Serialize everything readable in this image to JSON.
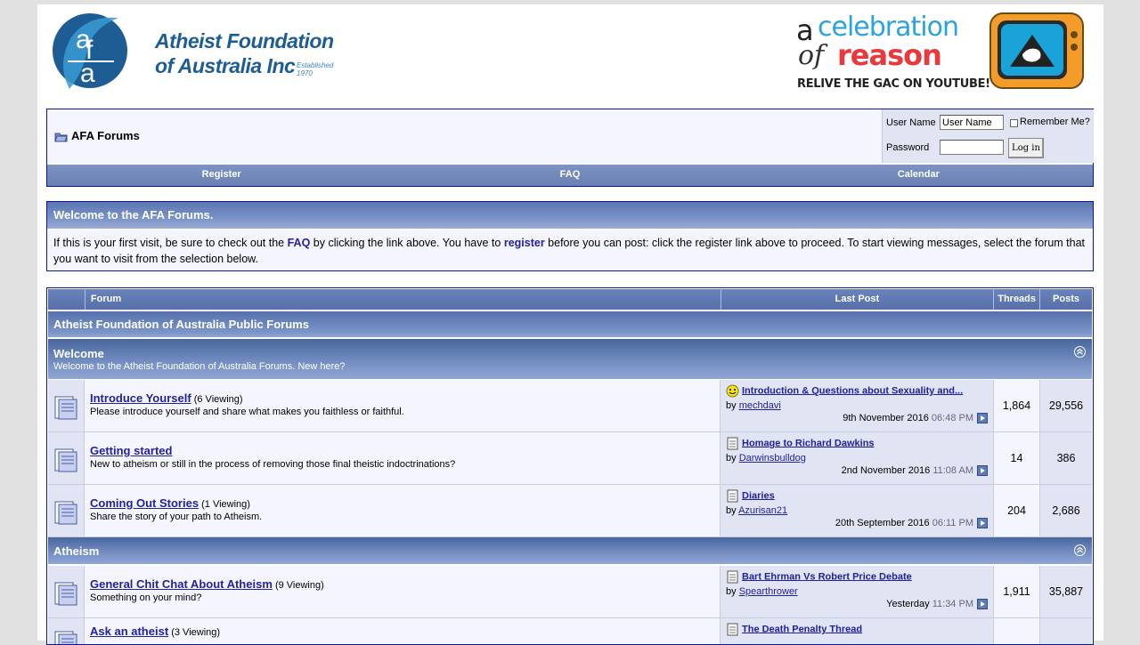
{
  "header": {
    "logo_title_line1": "Atheist Foundation",
    "logo_title_line2": "of Australia Inc",
    "logo_established": "Established 1970",
    "banner_a": "a",
    "banner_celebration": "celebration",
    "banner_of": "of",
    "banner_reason": "reason",
    "banner_relive": "RELIVE THE GAC ON YOUTUBE!"
  },
  "navbar": {
    "breadcrumb": "AFA Forums",
    "username_label": "User Name",
    "username_value": "User Name",
    "remember_label": "Remember Me?",
    "password_label": "Password",
    "login_button": "Log in",
    "links": [
      "Register",
      "FAQ",
      "Calendar"
    ]
  },
  "notice": {
    "title": "Welcome to the AFA Forums.",
    "text_1": "If this is your first visit, be sure to check out the ",
    "faq_link": "FAQ",
    "text_2": " by clicking the link above. You have to ",
    "register_link": "register",
    "text_3": " before you can post: click the register link above to proceed. To start viewing messages, select the forum that you want to visit from the selection below."
  },
  "forum_table": {
    "columns": {
      "forum": "Forum",
      "last_post": "Last Post",
      "threads": "Threads",
      "posts": "Posts"
    },
    "category": "Atheist Foundation of Australia Public Forums",
    "sections": [
      {
        "title": "Welcome",
        "description": "Welcome to the Atheist Foundation of Australia Forums. New here?",
        "forums": [
          {
            "name": "Introduce Yourself",
            "viewing": "(6 Viewing)",
            "description": "Please introduce yourself and share what makes you faithless or faithful.",
            "last_title": "Introduction & Questions about Sexuality and...",
            "last_by_prefix": "by ",
            "last_user": "mechdavi",
            "last_date": "9th November 2016",
            "last_time": "06:48 PM",
            "threads": "1,864",
            "posts": "29,556",
            "icon": "smiley"
          },
          {
            "name": "Getting started",
            "viewing": "",
            "description": "New to atheism or still in the process of removing those final theistic indoctrinations?",
            "last_title": "Homage to Richard Dawkins",
            "last_by_prefix": "by ",
            "last_user": "Darwinsbulldog",
            "last_date": "2nd November 2016",
            "last_time": "11:08 AM",
            "threads": "14",
            "posts": "386",
            "icon": "doc"
          },
          {
            "name": "Coming Out Stories",
            "viewing": "(1 Viewing)",
            "description": "Share the story of your path to Atheism.",
            "last_title": "Diaries",
            "last_by_prefix": "by ",
            "last_user": "Azurisan21",
            "last_date": "20th September 2016",
            "last_time": "06:11 PM",
            "threads": "204",
            "posts": "2,686",
            "icon": "doc"
          }
        ]
      },
      {
        "title": "Atheism",
        "description": "",
        "forums": [
          {
            "name": "General Chit Chat About Atheism",
            "viewing": "(9 Viewing)",
            "description": "Something on your mind?",
            "last_title": "Bart Ehrman Vs Robert Price Debate",
            "last_by_prefix": "by ",
            "last_user": "Spearthrower",
            "last_date": "Yesterday",
            "last_time": "11:34 PM",
            "threads": "1,911",
            "posts": "35,887",
            "icon": "doc"
          },
          {
            "name": "Ask an atheist",
            "viewing": "(3 Viewing)",
            "description": "",
            "last_title": "The Death Penalty Thread",
            "last_by_prefix": "",
            "last_user": "",
            "last_date": "",
            "last_time": "",
            "threads": "",
            "posts": "",
            "icon": "doc"
          }
        ]
      }
    ]
  }
}
